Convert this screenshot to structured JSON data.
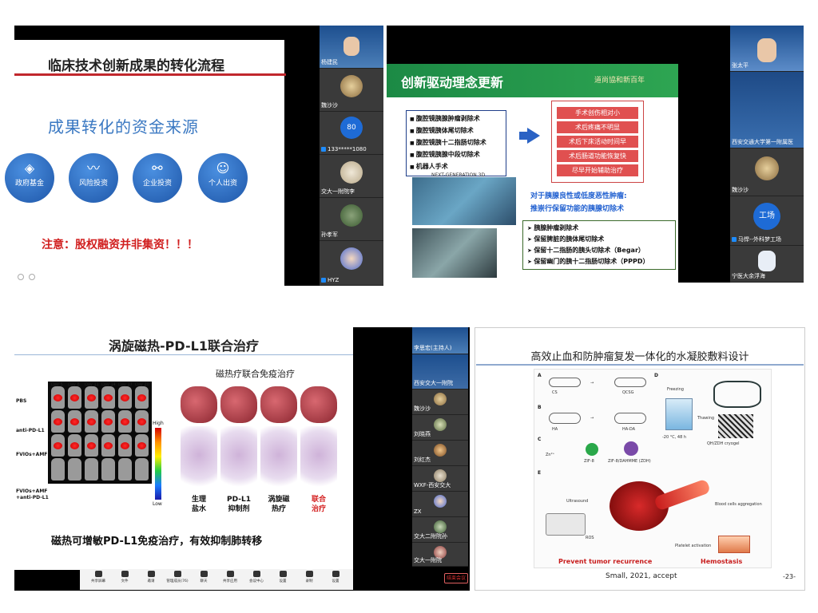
{
  "panel1": {
    "title": "临床技术创新成果的转化流程",
    "subtitle": "成果转化的资金来源",
    "funding_sources": [
      {
        "icon": "cube-icon",
        "label": "政府基金"
      },
      {
        "icon": "trend-icon",
        "label": "风险投资"
      },
      {
        "icon": "network-icon",
        "label": "企业投资"
      },
      {
        "icon": "person-icon",
        "label": "个人出资"
      }
    ],
    "note": "注意：股权融资并非集资！！！",
    "participants": [
      {
        "name": "杨建民"
      },
      {
        "name": "魏沙沙"
      },
      {
        "name": "133*****1080",
        "avatar_text": "80"
      },
      {
        "name": "交大一附院李"
      },
      {
        "name": "孙孝军"
      },
      {
        "name": "HYZ"
      }
    ]
  },
  "panel2": {
    "title": "创新驱动理念更新",
    "logo_text": "道尚協和新百年",
    "procedures": [
      "腹腔镜胰腺肿瘤剥除术",
      "腹腔镜胰体尾切除术",
      "腹腔镜胰十二指肠切除术",
      "腹腔镜胰腺中段切除术",
      "机器人手术"
    ],
    "benefits": [
      "手术创伤相对小",
      "术后疼痛不明显",
      "术后下床活动时间早",
      "术后肠道功能恢复快",
      "尽早开始辅助治疗"
    ],
    "photo_caption": "NEXT-GENERATION 3D",
    "recommendation": [
      "对于胰腺良性或低度恶性肿瘤:",
      "推崇行保留功能的胰腺切除术"
    ],
    "preserving": [
      "胰腺肿瘤剥除术",
      "保留脾脏的胰体尾切除术",
      "保留十二指肠的胰头切除术（Begar）",
      "保留幽门的胰十二指肠切除术（PPPD）"
    ],
    "participants": [
      {
        "name": "张太平"
      },
      {
        "name": "西安交通大学第一附属医"
      },
      {
        "name": "魏沙沙"
      },
      {
        "name": "马悍--外科梦工场",
        "avatar_text": "工场"
      },
      {
        "name": "宁医大余浮海"
      }
    ]
  },
  "panel3": {
    "title": "涡旋磁热-PD-L1联合治疗",
    "subtitle": "磁热疗联合免疫治疗",
    "days": [
      "Day 5",
      "Day 8",
      "Day 11",
      "Day 14",
      "Day 17",
      "Day 20"
    ],
    "groups": [
      "PBS",
      "anti-PD-L1",
      "FVIOs+AMF",
      "FVIOs+AMF\n+anti-PD-L1"
    ],
    "scale_high": "High",
    "scale_low": "Low",
    "treatments": [
      {
        "label": "生理\n盐水",
        "color": "#111111"
      },
      {
        "label": "PD-L1\n抑制剂",
        "color": "#111111"
      },
      {
        "label": "涡旋磁\n热疗",
        "color": "#111111"
      },
      {
        "label": "联合\n治疗",
        "color": "#d42020"
      }
    ],
    "conclusion": "磁热可增敏PD-L1免疫治疗，有效抑制肺转移",
    "toolbar": [
      "共享屏幕",
      "文件",
      "邀请",
      "管理成员(76)",
      "聊天",
      "共享应用",
      "会议中心",
      "设置",
      "录制",
      "设置"
    ],
    "leave_button": "结束会议",
    "participants": [
      {
        "name": "李思宏(主持人)"
      },
      {
        "name": "西安交大一附院"
      },
      {
        "name": "魏沙沙"
      },
      {
        "name": "刘晓燕"
      },
      {
        "name": "刘红杰"
      },
      {
        "name": "WXF-西安交大"
      },
      {
        "name": "ZX"
      },
      {
        "name": "交大二附院孙"
      },
      {
        "name": "交大一附院"
      }
    ]
  },
  "panel4": {
    "title": "高效止血和防肿瘤复发一体化的水凝胶敷料设计",
    "labels": {
      "A": "A",
      "B": "B",
      "C": "C",
      "D": "D",
      "E": "E",
      "cs": "CS",
      "qcsg": "QCSG",
      "ha": "HA",
      "hada": "HA-DA",
      "zn": "Zn²⁺",
      "zif8": "ZIF-8",
      "zif8dahmme": "ZIF-8/DAHMME (ZDH)",
      "freezing": "Freezing",
      "thawing": "Thawing",
      "cryogel": "QH/ZDH cryogel",
      "temp": "-20 °C, 48 h",
      "ultrasound": "Ultrasound",
      "ros": "ROS",
      "blood": "Blood cells aggregation",
      "platelet": "Platelet activation"
    },
    "prevent": "Prevent  tumor recurrence",
    "hemostasis": "Hemostasis",
    "citation": "Small, 2021, accept",
    "page": "-23-"
  }
}
